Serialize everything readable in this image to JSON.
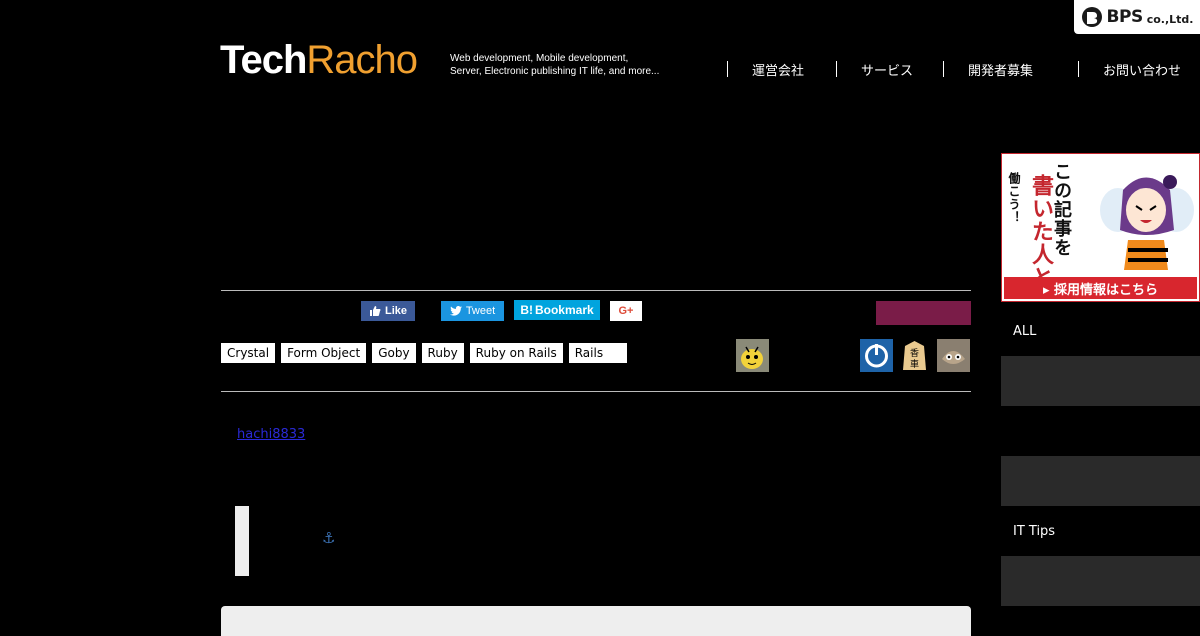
{
  "company": {
    "logo_text": "BPS",
    "suffix": "co.,Ltd."
  },
  "site": {
    "logo_part1": "Tech",
    "logo_part2": "Racho",
    "tagline_line1": "Web development, Mobile development,",
    "tagline_line2": "Server, Electronic publishing IT life, and more..."
  },
  "nav": [
    "運営会社",
    "サービス",
    "開発者募集",
    "お問い合わせ"
  ],
  "share": {
    "like": "Like",
    "tweet": "Tweet",
    "bookmark": "Bookmark",
    "gplus": "G+"
  },
  "tags": [
    "Crystal",
    "Form Object",
    "Goby",
    "Ruby",
    "Ruby on Rails",
    "Rails"
  ],
  "article": {
    "author": "hachi8833"
  },
  "banner": {
    "text_main": "この記事を",
    "text_red": "書いた人と",
    "text_small": "働こう！",
    "cta": "▸ 採用情報はこちら"
  },
  "sidebar": {
    "label_all": "ALL",
    "label_it_tips": "IT Tips"
  },
  "colors": {
    "accent_orange": "#f0a030",
    "facebook": "#3b5998",
    "twitter": "#1b95e0",
    "hatena": "#00a4de",
    "banner_red": "#d8262e"
  }
}
